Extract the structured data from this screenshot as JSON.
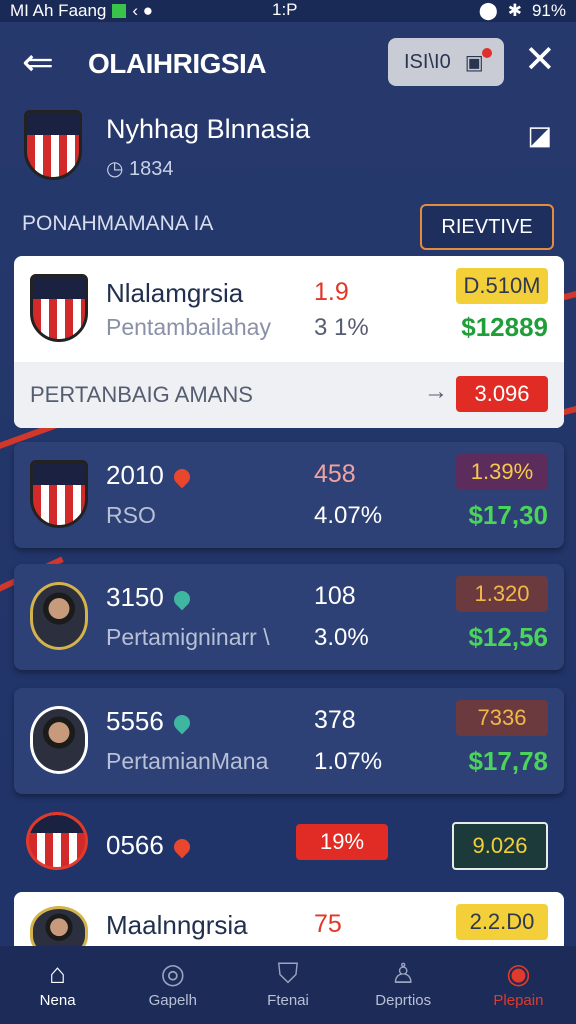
{
  "status": {
    "left": "MI Ah Faang",
    "time": "1:P",
    "battery": "91%"
  },
  "header": {
    "title": "OLAIHRIGSIA",
    "pill_label": "ISI\\I0"
  },
  "team": {
    "name": "Nyhhag Blnnasia",
    "sub": "1834"
  },
  "section": {
    "label": "PONAHMAMANA IA",
    "button": "RIEVTIVE"
  },
  "featured": {
    "name": "Nlalamgrsia",
    "sub": "Pentambailahay",
    "odds": "1.9",
    "pct": "3 1%",
    "badge": "D.510M",
    "money": "$12889",
    "footer": "PERTANBAIG AMANS",
    "footer_badge": "3.096"
  },
  "rows": [
    {
      "name": "2010",
      "sub": "RSO",
      "odds": "458",
      "pct": "4.07%",
      "badge": "1.39%",
      "money": "$17,30",
      "heart": "#e8472d"
    },
    {
      "name": "3150",
      "sub": "Pertamigninarr \\",
      "odds": "108",
      "pct": "3.0%",
      "badge": "1.320",
      "money": "$12,56",
      "heart": "#3fb7a0"
    },
    {
      "name": "5556",
      "sub": "PertamianMana",
      "odds": "378",
      "pct": "1.07%",
      "badge": "7336",
      "money": "$17,78",
      "heart": "#3fb7a0"
    }
  ],
  "row4": {
    "name": "0566",
    "badge": "19%",
    "value": "9.026"
  },
  "row5": {
    "name": "Maalnngrsia",
    "odds": "75",
    "badge": "2.2.D0"
  },
  "nav": [
    {
      "label": "Nena",
      "icon": "home-icon"
    },
    {
      "label": "Gapelh",
      "icon": "search-icon"
    },
    {
      "label": "Ftenai",
      "icon": "shield-icon"
    },
    {
      "label": "Deprtios",
      "icon": "user-icon"
    },
    {
      "label": "Plepain",
      "icon": "profile-icon"
    }
  ]
}
